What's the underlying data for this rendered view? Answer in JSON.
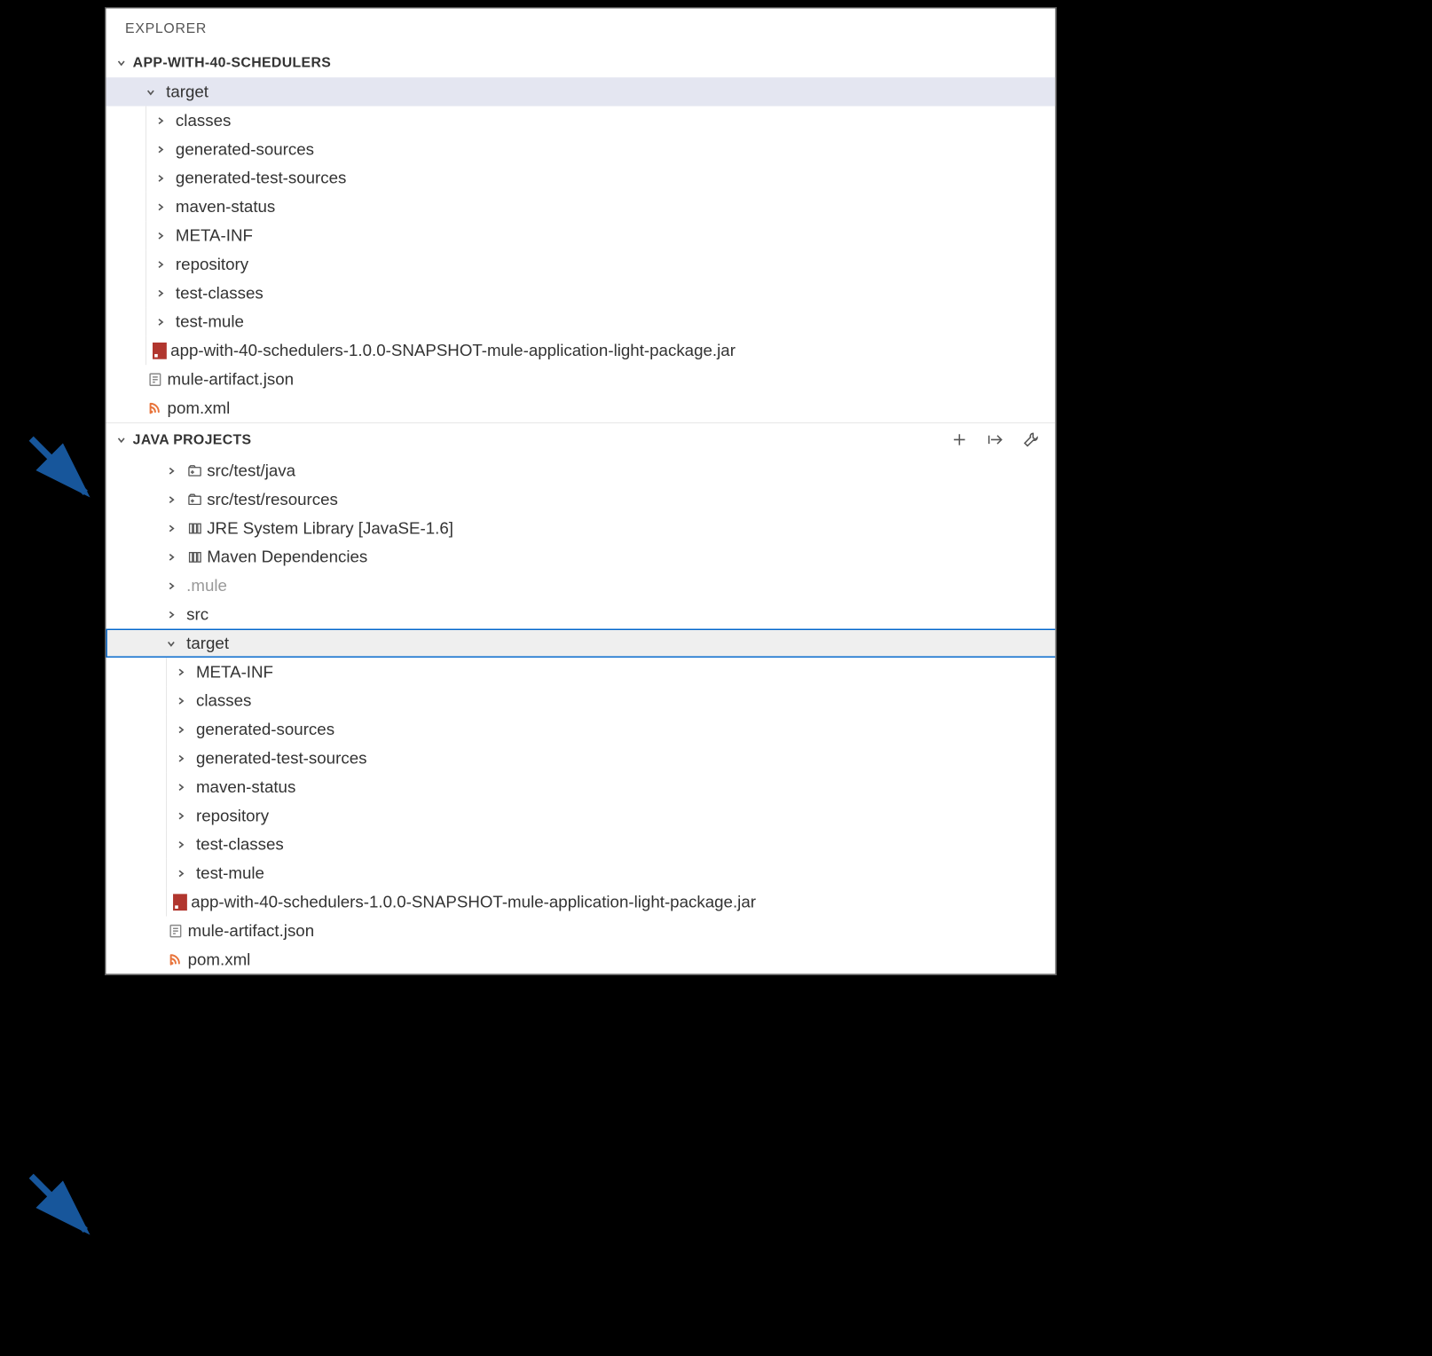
{
  "explorer": {
    "title": "EXPLORER",
    "project_section": {
      "label": "APP-WITH-40-SCHEDULERS",
      "target": {
        "label": "target",
        "children": [
          "classes",
          "generated-sources",
          "generated-test-sources",
          "maven-status",
          "META-INF",
          "repository",
          "test-classes",
          "test-mule"
        ],
        "jar_file": "app-with-40-schedulers-1.0.0-SNAPSHOT-mule-application-light-package.jar"
      },
      "mule_artifact": "mule-artifact.json",
      "pom": "pom.xml"
    },
    "java_projects_section": {
      "label": "JAVA PROJECTS",
      "items": [
        {
          "label": "src/test/java",
          "icon": "pkg"
        },
        {
          "label": "src/test/resources",
          "icon": "pkg"
        },
        {
          "label": "JRE System Library [JavaSE-1.6]",
          "icon": "lib"
        },
        {
          "label": "Maven Dependencies",
          "icon": "lib"
        },
        {
          "label": ".mule",
          "icon": "none",
          "greyed": true
        },
        {
          "label": "src",
          "icon": "none"
        }
      ],
      "target": {
        "label": "target",
        "children": [
          "META-INF",
          "classes",
          "generated-sources",
          "generated-test-sources",
          "maven-status",
          "repository",
          "test-classes",
          "test-mule"
        ],
        "jar_file": "app-with-40-schedulers-1.0.0-SNAPSHOT-mule-application-light-package.jar"
      },
      "mule_artifact": "mule-artifact.json",
      "pom": "pom.xml"
    }
  }
}
